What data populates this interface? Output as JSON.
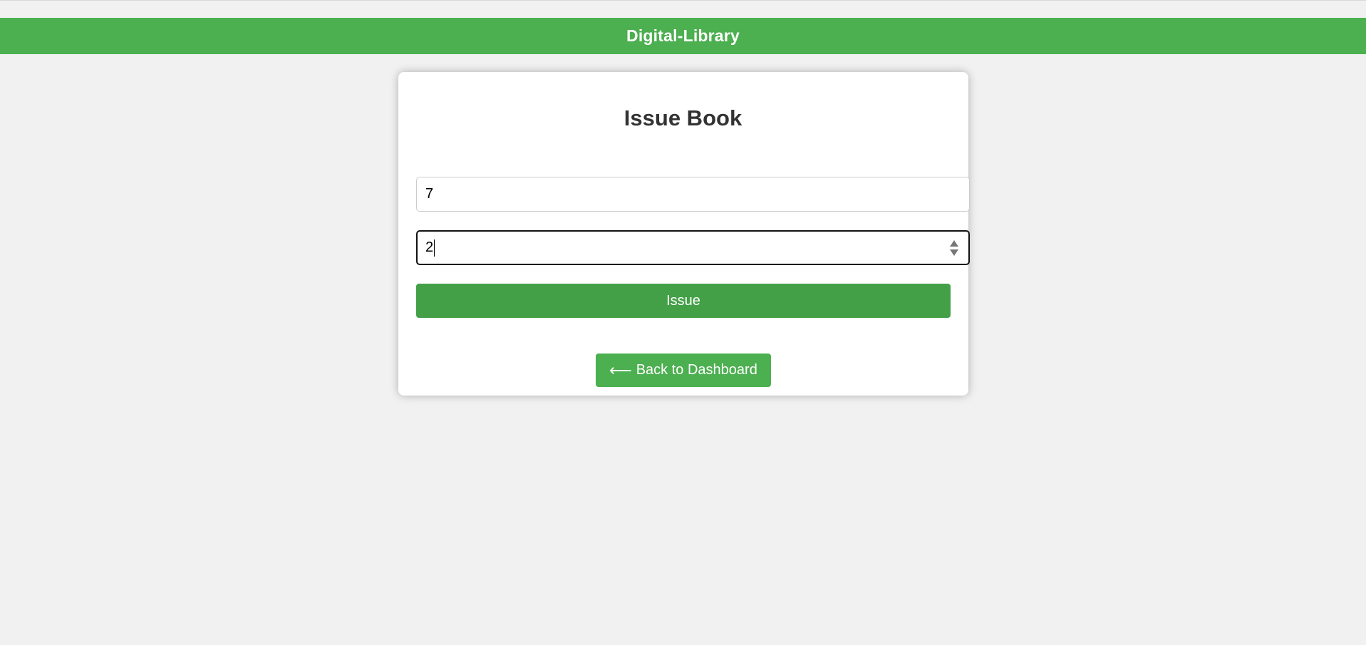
{
  "header": {
    "title": "Digital-Library"
  },
  "form": {
    "title": "Issue Book",
    "field_1_value": "7",
    "field_2_value": "2",
    "issue_label": "Issue",
    "back_arrow": "⟵",
    "back_label": "Back to Dashboard"
  },
  "colors": {
    "brand_green": "#4caf50",
    "button_green": "#43a047",
    "background": "#f1f1f1"
  },
  "icons": {
    "back": "left-arrow-icon",
    "spinner": "number-spinner-icon"
  }
}
